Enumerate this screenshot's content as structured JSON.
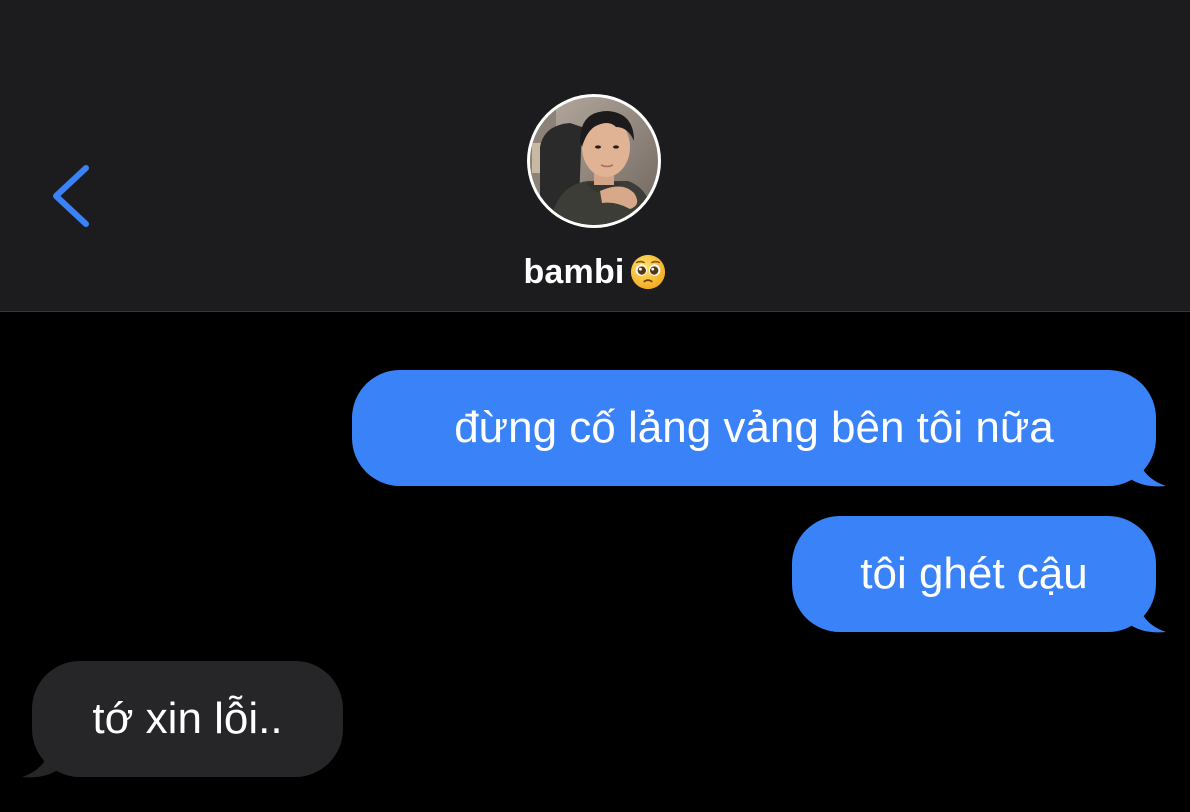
{
  "header": {
    "back_icon": "chevron-left-icon",
    "contact_name": "bambi",
    "contact_emoji_icon": "pleading-face-icon",
    "avatar": "contact-avatar-photo"
  },
  "colors": {
    "header_bg": "#1c1c1e",
    "chat_bg": "#000000",
    "sent_bubble": "#3a82f7",
    "received_bubble": "#262628",
    "accent": "#3a82f7"
  },
  "messages": [
    {
      "direction": "sent",
      "text": "đừng cố lảng vảng bên tôi nữa"
    },
    {
      "direction": "sent",
      "text": "tôi ghét cậu"
    },
    {
      "direction": "received",
      "text": "tớ xin lỗi.."
    }
  ]
}
